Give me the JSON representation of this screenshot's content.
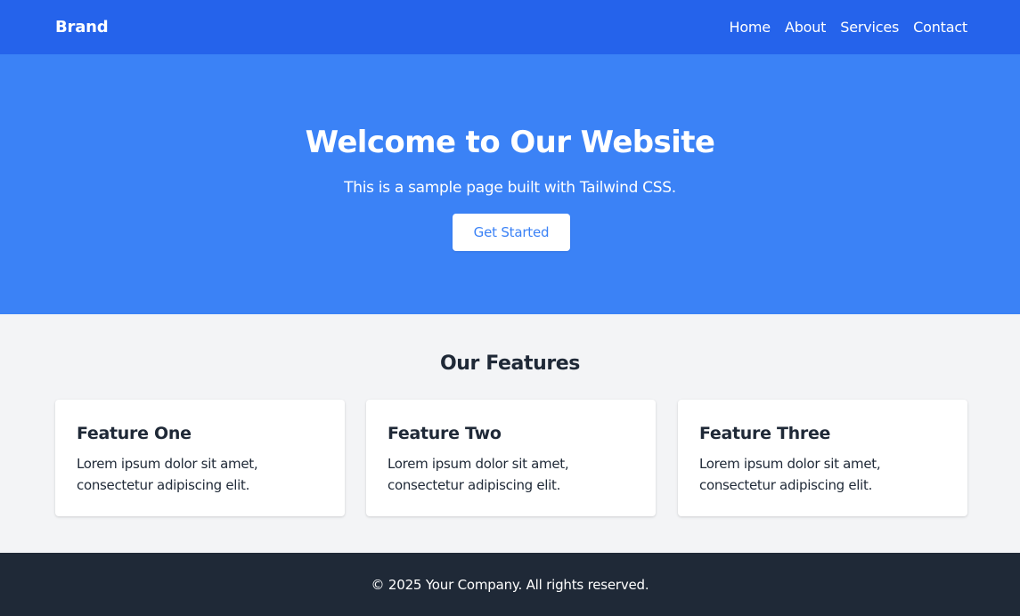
{
  "navbar": {
    "brand": "Brand",
    "links": [
      "Home",
      "About",
      "Services",
      "Contact"
    ]
  },
  "hero": {
    "title": "Welcome to Our Website",
    "subtitle": "This is a sample page built with Tailwind CSS.",
    "button_label": "Get Started"
  },
  "features": {
    "title": "Our Features",
    "cards": [
      {
        "title": "Feature One",
        "text": "Lorem ipsum dolor sit amet, consectetur adipiscing elit."
      },
      {
        "title": "Feature Two",
        "text": "Lorem ipsum dolor sit amet, consectetur adipiscing elit."
      },
      {
        "title": "Feature Three",
        "text": "Lorem ipsum dolor sit amet, consectetur adipiscing elit."
      }
    ]
  },
  "footer": {
    "text": "© 2025 Your Company. All rights reserved."
  },
  "colors": {
    "navbar_bg": "#2563eb",
    "hero_bg": "#3b82f6",
    "page_bg": "#f3f4f6",
    "footer_bg": "#1f2937",
    "text_dark": "#1f2937",
    "white": "#ffffff"
  }
}
